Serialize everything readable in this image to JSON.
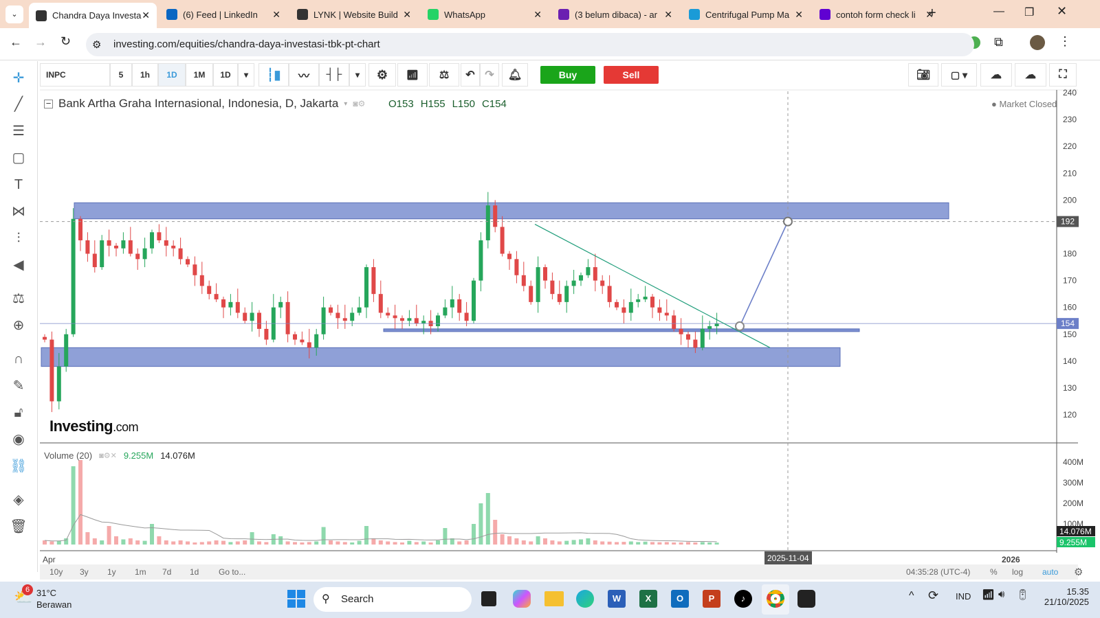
{
  "browser": {
    "tabs": [
      {
        "label": "Chandra Daya Investa",
        "icon": "investing-icon",
        "color": "#333"
      },
      {
        "label": "(6) Feed | LinkedIn",
        "icon": "linkedin-icon",
        "color": "#0a66c2"
      },
      {
        "label": "LYNK | Website Build",
        "icon": "lynk-icon",
        "color": "#333"
      },
      {
        "label": "WhatsApp",
        "icon": "whatsapp-icon",
        "color": "#25d366"
      },
      {
        "label": "(3 belum dibaca) - ar",
        "icon": "mail-icon",
        "color": "#6b1fb1"
      },
      {
        "label": "Centrifugal Pump Ma",
        "icon": "circle-icon",
        "color": "#1a9bd7"
      },
      {
        "label": "contoh form check li",
        "icon": "yahoo-icon",
        "color": "#6001d2"
      }
    ],
    "url": "investing.com/equities/chandra-daya-investasi-tbk-pt-chart"
  },
  "toolbar": {
    "symbol": "INPC",
    "intervals": [
      "5",
      "1h",
      "1D",
      "1M",
      "1D"
    ],
    "active_interval": "1D",
    "buy": "Buy",
    "sell": "Sell"
  },
  "legend": {
    "title": "Bank Artha Graha Internasional, Indonesia, D, Jakarta",
    "open": "O153",
    "high": "H155",
    "low": "L150",
    "close": "C154",
    "market_status": "Market Closed"
  },
  "volume_legend": {
    "label": "Volume (20)",
    "v1": "9.255M",
    "v2": "14.076M"
  },
  "price_axis": {
    "labels": [
      "240",
      "230",
      "220",
      "210",
      "200",
      "180",
      "170",
      "160",
      "150",
      "140",
      "130",
      "120"
    ],
    "current_price": "154",
    "crosshair_price": "192"
  },
  "volume_axis": {
    "labels": [
      "400M",
      "300M",
      "200M",
      "100M"
    ],
    "tag1": "14.076M",
    "tag2": "9.255M"
  },
  "time_axis": {
    "start": "Apr",
    "crosshair_date": "2025-11-04",
    "end": "2026"
  },
  "bottom": {
    "ranges": [
      "10y",
      "3y",
      "1y",
      "1m",
      "7d",
      "1d",
      "Go to..."
    ],
    "clock": "04:35:28 (UTC-4)",
    "percent": "%",
    "log": "log",
    "auto": "auto"
  },
  "logo": {
    "text": "Investing",
    "suffix": ".com"
  },
  "taskbar": {
    "weather_temp": "31°C",
    "weather_desc": "Berawan",
    "weather_badge": "6",
    "search": "Search",
    "lang": "IND",
    "time": "15.35",
    "date": "21/10/2025"
  },
  "colors": {
    "up": "#26a65b",
    "down": "#e04848",
    "zone": "#7b8fd0",
    "accent": "#3a9ad9"
  },
  "chart_data": {
    "type": "candlestick",
    "price_range": [
      115,
      242
    ],
    "closes": [
      148,
      125,
      138,
      150,
      193,
      185,
      180,
      175,
      185,
      183,
      182,
      185,
      180,
      178,
      182,
      188,
      185,
      183,
      182,
      178,
      176,
      172,
      168,
      165,
      163,
      160,
      162,
      158,
      155,
      158,
      152,
      148,
      160,
      162,
      150,
      148,
      147,
      145,
      150,
      160,
      158,
      156,
      155,
      158,
      160,
      175,
      165,
      158,
      157,
      156,
      155,
      156,
      154,
      155,
      153,
      157,
      160,
      163,
      158,
      155,
      170,
      185,
      198,
      190,
      180,
      178,
      172,
      168,
      162,
      175,
      170,
      165,
      162,
      168,
      170,
      172,
      175,
      170,
      168,
      162,
      160,
      158,
      162,
      163,
      164,
      160,
      158,
      157,
      152,
      150,
      148,
      145,
      152,
      153,
      154
    ],
    "volumes_m": [
      20,
      15,
      18,
      30,
      380,
      410,
      60,
      30,
      20,
      90,
      40,
      25,
      30,
      20,
      18,
      100,
      40,
      20,
      15,
      20,
      15,
      10,
      12,
      15,
      20,
      18,
      12,
      15,
      20,
      60,
      15,
      12,
      50,
      40,
      15,
      12,
      10,
      12,
      15,
      85,
      20,
      15,
      12,
      10,
      18,
      90,
      30,
      20,
      15,
      12,
      10,
      18,
      12,
      15,
      10,
      20,
      80,
      30,
      15,
      20,
      100,
      200,
      250,
      120,
      50,
      40,
      30,
      20,
      15,
      40,
      30,
      20,
      15,
      18,
      22,
      25,
      30,
      20,
      15,
      14,
      12,
      13,
      15,
      12,
      14,
      12,
      11,
      12,
      10,
      10,
      12,
      10,
      12,
      10,
      9.255
    ],
    "zones": [
      {
        "low": 193,
        "high": 199
      },
      {
        "low": 138,
        "high": 145
      }
    ],
    "support_line": 151.5,
    "target": 192
  }
}
